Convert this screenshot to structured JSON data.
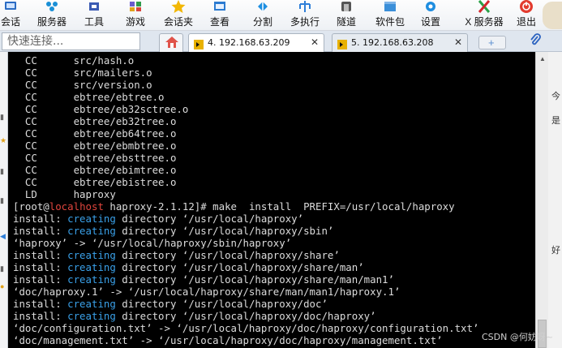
{
  "toolbar": {
    "items": [
      {
        "label": "会话",
        "icon": "session-icon",
        "color": "#2b6cc4"
      },
      {
        "label": "服务器",
        "icon": "servers-icon",
        "color": "#1a8fd6"
      },
      {
        "label": "工具",
        "icon": "tools-icon",
        "color": "#3b5bb3"
      },
      {
        "label": "游戏",
        "icon": "games-icon",
        "color": "#6a5acd"
      },
      {
        "label": "会话夹",
        "icon": "sessions-folder-icon",
        "color": "#f2b705"
      },
      {
        "label": "查看",
        "icon": "view-icon",
        "color": "#2b7bd1"
      },
      {
        "label": "分割",
        "icon": "split-icon",
        "color": "#1d8fe1"
      },
      {
        "label": "多执行",
        "icon": "multi-exec-icon",
        "color": "#2f7fd8"
      },
      {
        "label": "隧道",
        "icon": "tunnel-icon",
        "color": "#555555"
      },
      {
        "label": "软件包",
        "icon": "packages-icon",
        "color": "#3b8fd9"
      },
      {
        "label": "设置",
        "icon": "settings-icon",
        "color": "#1f8ee0"
      },
      {
        "label": "X 服务器",
        "icon": "x-server-icon",
        "color": "#d4262c"
      },
      {
        "label": "退出",
        "icon": "exit-icon",
        "color": "#e23b2e"
      }
    ]
  },
  "quick_connect": {
    "placeholder": "快速连接..."
  },
  "tabs": [
    {
      "label": "4. 192.168.63.209",
      "active": true
    },
    {
      "label": "5. 192.168.63.208",
      "active": false
    }
  ],
  "right_strip": {
    "chars": [
      "今",
      "是",
      "好"
    ]
  },
  "terminal": {
    "lines": [
      {
        "segments": [
          {
            "text": "  CC      src/hash.o",
            "color": "default"
          }
        ]
      },
      {
        "segments": [
          {
            "text": "  CC      src/mailers.o",
            "color": "default"
          }
        ]
      },
      {
        "segments": [
          {
            "text": "  CC      src/version.o",
            "color": "default"
          }
        ]
      },
      {
        "segments": [
          {
            "text": "  CC      ebtree/ebtree.o",
            "color": "default"
          }
        ]
      },
      {
        "segments": [
          {
            "text": "  CC      ebtree/eb32sctree.o",
            "color": "default"
          }
        ]
      },
      {
        "segments": [
          {
            "text": "  CC      ebtree/eb32tree.o",
            "color": "default"
          }
        ]
      },
      {
        "segments": [
          {
            "text": "  CC      ebtree/eb64tree.o",
            "color": "default"
          }
        ]
      },
      {
        "segments": [
          {
            "text": "  CC      ebtree/ebmbtree.o",
            "color": "default"
          }
        ]
      },
      {
        "segments": [
          {
            "text": "  CC      ebtree/ebsttree.o",
            "color": "default"
          }
        ]
      },
      {
        "segments": [
          {
            "text": "  CC      ebtree/ebimtree.o",
            "color": "default"
          }
        ]
      },
      {
        "segments": [
          {
            "text": "  CC      ebtree/ebistree.o",
            "color": "default"
          }
        ]
      },
      {
        "segments": [
          {
            "text": "  LD      haproxy",
            "color": "default"
          }
        ]
      },
      {
        "segments": [
          {
            "text": "[root@",
            "color": "default"
          },
          {
            "text": "localhost",
            "color": "red"
          },
          {
            "text": " haproxy-2.1.12]# make  install  PREFIX=/usr/local/haproxy",
            "color": "default"
          }
        ]
      },
      {
        "segments": [
          {
            "text": "install: ",
            "color": "default"
          },
          {
            "text": "creating",
            "color": "blue"
          },
          {
            "text": " directory ‘/usr/local/haproxy’",
            "color": "default"
          }
        ]
      },
      {
        "segments": [
          {
            "text": "install: ",
            "color": "default"
          },
          {
            "text": "creating",
            "color": "blue"
          },
          {
            "text": " directory ‘/usr/local/haproxy/sbin’",
            "color": "default"
          }
        ]
      },
      {
        "segments": [
          {
            "text": "‘haproxy’ -> ‘/usr/local/haproxy/sbin/haproxy’",
            "color": "default"
          }
        ]
      },
      {
        "segments": [
          {
            "text": "install: ",
            "color": "default"
          },
          {
            "text": "creating",
            "color": "blue"
          },
          {
            "text": " directory ‘/usr/local/haproxy/share’",
            "color": "default"
          }
        ]
      },
      {
        "segments": [
          {
            "text": "install: ",
            "color": "default"
          },
          {
            "text": "creating",
            "color": "blue"
          },
          {
            "text": " directory ‘/usr/local/haproxy/share/man’",
            "color": "default"
          }
        ]
      },
      {
        "segments": [
          {
            "text": "install: ",
            "color": "default"
          },
          {
            "text": "creating",
            "color": "blue"
          },
          {
            "text": " directory ‘/usr/local/haproxy/share/man/man1’",
            "color": "default"
          }
        ]
      },
      {
        "segments": [
          {
            "text": "‘doc/haproxy.1’ -> ‘/usr/local/haproxy/share/man/man1/haproxy.1’",
            "color": "default"
          }
        ]
      },
      {
        "segments": [
          {
            "text": "install: ",
            "color": "default"
          },
          {
            "text": "creating",
            "color": "blue"
          },
          {
            "text": " directory ‘/usr/local/haproxy/doc’",
            "color": "default"
          }
        ]
      },
      {
        "segments": [
          {
            "text": "install: ",
            "color": "default"
          },
          {
            "text": "creating",
            "color": "blue"
          },
          {
            "text": " directory ‘/usr/local/haproxy/doc/haproxy’",
            "color": "default"
          }
        ]
      },
      {
        "segments": [
          {
            "text": "‘doc/configuration.txt’ -> ‘/usr/local/haproxy/doc/haproxy/configuration.txt’",
            "color": "default"
          }
        ]
      },
      {
        "segments": [
          {
            "text": "‘doc/management.txt’ -> ‘/usr/local/haproxy/doc/haproxy/management.txt’",
            "color": "default"
          }
        ]
      }
    ]
  },
  "watermark": "CSDN @何妨呀~",
  "colors": {
    "prompt_host": "#e0453d",
    "creating": "#3aa0e8",
    "terminal_bg": "#000000",
    "terminal_fg": "#dcdcdc"
  }
}
